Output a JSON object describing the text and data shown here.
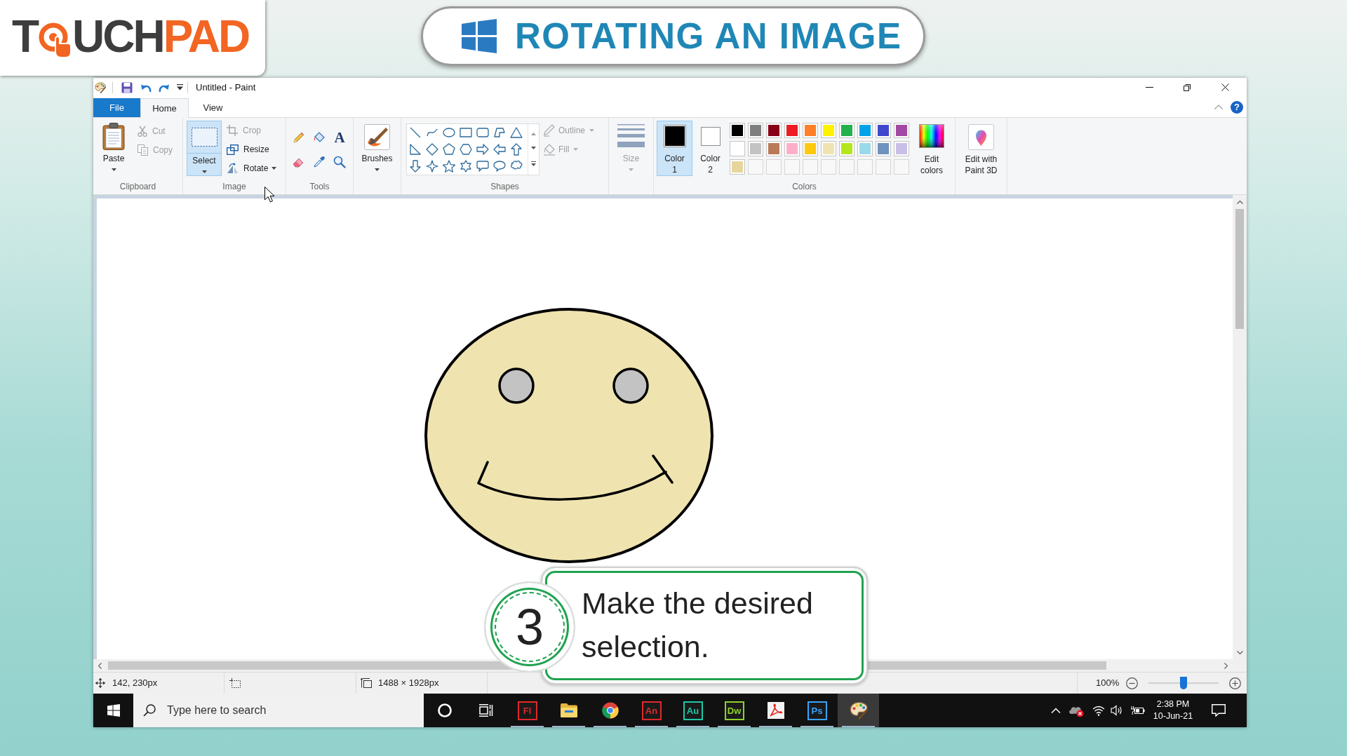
{
  "logo": {
    "parts": [
      {
        "kind": "letters",
        "text": "T",
        "color": "#3d3d3d"
      },
      {
        "kind": "touch_mark"
      },
      {
        "kind": "letters",
        "text": "UCH",
        "color": "#3d3d3d"
      },
      {
        "kind": "letters",
        "text": "PAD",
        "color": "#f26522"
      }
    ]
  },
  "banner": {
    "title": "ROTATING AN IMAGE"
  },
  "window": {
    "title": "Untitled - Paint"
  },
  "tabs": [
    {
      "label": "File",
      "kind": "menu",
      "selected": false
    },
    {
      "label": "Home",
      "kind": "tab",
      "selected": true
    },
    {
      "label": "View",
      "kind": "tab",
      "selected": false
    }
  ],
  "ribbon_help": "?",
  "ribbon": {
    "clipboard": {
      "label": "Clipboard",
      "paste": "Paste",
      "actions": [
        {
          "kind": "cut",
          "label": "Cut",
          "disabled": true
        },
        {
          "kind": "copy",
          "label": "Copy",
          "disabled": true
        }
      ]
    },
    "image": {
      "label": "Image",
      "select": {
        "label": "Select",
        "selected": true
      },
      "actions": [
        {
          "kind": "crop",
          "label": "Crop",
          "disabled": true
        },
        {
          "kind": "resize",
          "label": "Resize",
          "disabled": false
        },
        {
          "kind": "rotate",
          "label": "Rotate",
          "disabled": false
        }
      ]
    },
    "tools": {
      "label": "Tools",
      "text_tool": "A"
    },
    "brushes": {
      "label": "Brushes"
    },
    "shapes": {
      "label": "Shapes",
      "options": [
        {
          "kind": "outline",
          "label": "Outline",
          "disabled": true
        },
        {
          "kind": "fill",
          "label": "Fill",
          "disabled": true
        }
      ]
    },
    "size": {
      "label": "Size",
      "disabled": true
    },
    "colors": {
      "label": "Colors",
      "slots": [
        {
          "label": "Color 1",
          "color": "#000000",
          "selected": true
        },
        {
          "label": "Color 2",
          "color": "#ffffff",
          "selected": false
        }
      ],
      "palette": [
        {
          "color": "#000000"
        },
        {
          "color": "#7f7f7f"
        },
        {
          "color": "#880015"
        },
        {
          "color": "#ed1c24"
        },
        {
          "color": "#ff7f27"
        },
        {
          "color": "#fff200"
        },
        {
          "color": "#22b14c"
        },
        {
          "color": "#00a2e8"
        },
        {
          "color": "#3f48cc"
        },
        {
          "color": "#a349a4"
        },
        {
          "color": "#ffffff"
        },
        {
          "color": "#c3c3c3"
        },
        {
          "color": "#b97a57"
        },
        {
          "color": "#ffaec9"
        },
        {
          "color": "#ffc90e"
        },
        {
          "color": "#efe4b0"
        },
        {
          "color": "#b5e61d"
        },
        {
          "color": "#99d9ea"
        },
        {
          "color": "#7092be"
        },
        {
          "color": "#c8bfe7"
        },
        {
          "color": "#e7d69b"
        }
      ],
      "edit": "Edit colors"
    },
    "paint3d": {
      "label": "Edit with Paint 3D"
    }
  },
  "status_bar": {
    "cursor": "142, 230px",
    "image_size": "1488 × 1928px",
    "zoom": "100%",
    "zoom_slider": {
      "level": 0.5
    }
  },
  "taskbar": {
    "search": {
      "placeholder": "Type here to search"
    },
    "apps": [
      {
        "kind": "ring",
        "running": false,
        "active": false
      },
      {
        "kind": "task_view",
        "running": false,
        "active": false
      },
      {
        "kind": "letter_tile",
        "label": "Fl",
        "color": "#e0292a",
        "running": true,
        "active": false
      },
      {
        "kind": "folder",
        "running": true,
        "active": false
      },
      {
        "kind": "browser",
        "running": true,
        "active": false
      },
      {
        "kind": "letter_tile",
        "label": "An",
        "color": "#e0292a",
        "running": true,
        "active": false
      },
      {
        "kind": "letter_tile",
        "label": "Au",
        "color": "#1fc6a6",
        "running": true,
        "active": false
      },
      {
        "kind": "letter_tile",
        "label": "Dw",
        "color": "#8fd12e",
        "running": true,
        "active": false
      },
      {
        "kind": "pdf",
        "running": true,
        "active": false
      },
      {
        "kind": "letter_tile",
        "label": "Ps",
        "color": "#3aa3ff",
        "running": true,
        "active": false
      },
      {
        "kind": "palette",
        "running": true,
        "active": true
      }
    ],
    "clock": {
      "time": "2:38 PM",
      "date": "10-Jun-21"
    }
  },
  "callout": {
    "step": "3",
    "text": "Make the desired selection."
  }
}
